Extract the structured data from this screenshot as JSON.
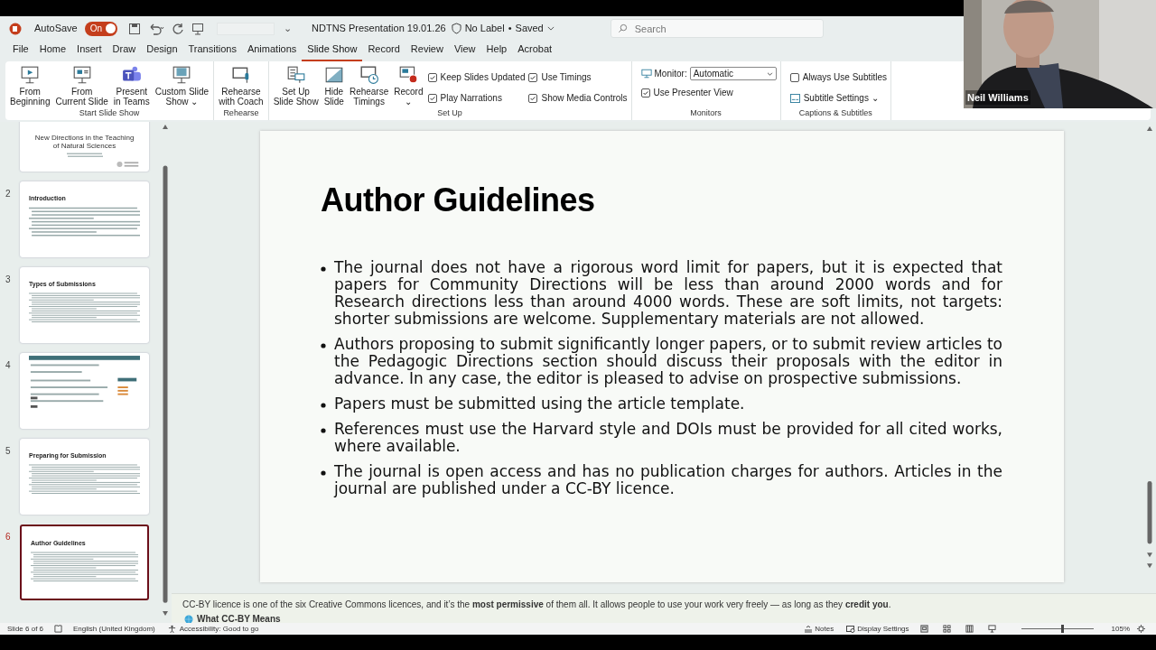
{
  "title_bar": {
    "autosave_label": "AutoSave",
    "autosave_on": true,
    "autosave_state": "On",
    "customize_caret": "⌄",
    "document_title": "NDTNS Presentation 19.01.26",
    "sensitivity": "No Label",
    "separator": "•",
    "save_state": "Saved",
    "search": {
      "placeholder": "Search"
    }
  },
  "ribbon_tabs": [
    {
      "label": "File",
      "selected": false
    },
    {
      "label": "Home",
      "selected": false
    },
    {
      "label": "Insert",
      "selected": false
    },
    {
      "label": "Draw",
      "selected": false
    },
    {
      "label": "Design",
      "selected": false
    },
    {
      "label": "Transitions",
      "selected": false
    },
    {
      "label": "Animations",
      "selected": false
    },
    {
      "label": "Slide Show",
      "selected": true
    },
    {
      "label": "Record",
      "selected": false
    },
    {
      "label": "Review",
      "selected": false
    },
    {
      "label": "View",
      "selected": false
    },
    {
      "label": "Help",
      "selected": false
    },
    {
      "label": "Acrobat",
      "selected": false
    }
  ],
  "ribbon_groups": [
    {
      "name": "Start Slide Show",
      "items": [
        {
          "kind": "button",
          "lines": [
            "From",
            "Beginning"
          ]
        },
        {
          "kind": "button",
          "lines": [
            "From",
            "Current Slide"
          ]
        },
        {
          "kind": "button",
          "lines": [
            "Present",
            "in Teams"
          ]
        },
        {
          "kind": "button",
          "lines": [
            "Custom Slide",
            "Show ⌄"
          ]
        }
      ]
    },
    {
      "name": "Rehearse",
      "items": [
        {
          "kind": "button",
          "lines": [
            "Rehearse",
            "with Coach"
          ]
        }
      ]
    },
    {
      "name": "Set Up",
      "items": [
        {
          "kind": "button",
          "lines": [
            "Set Up",
            "Slide Show"
          ]
        },
        {
          "kind": "button",
          "lines": [
            "Hide",
            "Slide"
          ]
        },
        {
          "kind": "button",
          "lines": [
            "Rehearse",
            "Timings"
          ]
        },
        {
          "kind": "button",
          "lines": [
            "Record",
            "⌄"
          ]
        },
        {
          "kind": "checks",
          "checks": [
            {
              "label": "Keep Slides Updated",
              "checked": true
            },
            {
              "label": "Play Narrations",
              "checked": true
            }
          ]
        },
        {
          "kind": "checks",
          "checks": [
            {
              "label": "Use Timings",
              "checked": true
            },
            {
              "label": "Show Media Controls",
              "checked": true
            }
          ]
        }
      ]
    },
    {
      "name": "Monitors",
      "items": [
        {
          "kind": "monitor",
          "label": "Monitor:",
          "value": "Automatic",
          "check": {
            "label": "Use Presenter View",
            "checked": true
          }
        }
      ]
    },
    {
      "name": "Captions & Subtitles",
      "items": [
        {
          "kind": "subtitles",
          "check": {
            "label": "Always Use Subtitles",
            "checked": false
          },
          "menu": "Subtitle Settings ⌄"
        }
      ]
    }
  ],
  "slides": [
    {
      "kind": "cover",
      "title": "New Directions in the Teaching of Natural Sciences",
      "selected": false
    },
    {
      "number": "2",
      "kind": "text",
      "title": "Introduction",
      "selected": false
    },
    {
      "number": "3",
      "kind": "text",
      "title": "Types of Submissions",
      "selected": false
    },
    {
      "number": "4",
      "kind": "web",
      "selected": false
    },
    {
      "number": "5",
      "kind": "text",
      "title": "Preparing for Submission",
      "selected": false
    },
    {
      "number": "6",
      "kind": "text",
      "title": "Author Guidelines",
      "selected": true
    }
  ],
  "current_slide": {
    "title": "Author Guidelines",
    "bullets": [
      "The journal does not have a rigorous word limit for papers, but it is expected that papers for Community Directions will be less than around 2000 words and for Research directions less than around 4000 words. These are soft limits, not targets: shorter submissions are welcome. Supplementary materials are not allowed.",
      "Authors proposing to submit significantly longer papers, or to submit review articles to the Pedagogic Directions section should discuss their proposals with the editor in advance. In any case, the editor is pleased to advise on prospective submissions.",
      "Papers must be submitted using the article template.",
      "References must use the Harvard style and DOIs must be provided for all cited works, where available.",
      "The journal is open access and has no publication charges for authors. Articles in the journal are published under a CC-BY licence."
    ]
  },
  "notes": {
    "text": "CC-BY licence is one of the six Creative Commons licences, and it’s the **most permissive** of them all. It allows people to use your work very freely — as long as they **credit you**.",
    "heading": "What CC-BY Means"
  },
  "status_bar": {
    "slide_count": "Slide 6 of 6",
    "language": "English (United Kingdom)",
    "accessibility": "Accessibility: Good to go",
    "notes": "Notes",
    "display_settings": "Display Settings",
    "zoom_slider": {
      "level": 0.55
    },
    "zoom": "105%"
  },
  "video": {
    "name": "Neil Williams"
  }
}
